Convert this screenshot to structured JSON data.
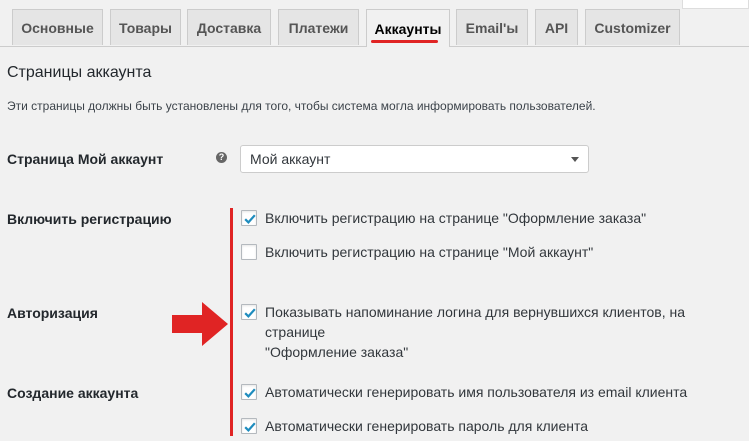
{
  "tabs": [
    {
      "label": "Основные"
    },
    {
      "label": "Товары"
    },
    {
      "label": "Доставка"
    },
    {
      "label": "Платежи"
    },
    {
      "label": "Аккаунты"
    },
    {
      "label": "Email'ы"
    },
    {
      "label": "API"
    },
    {
      "label": "Customizer"
    }
  ],
  "active_tab": "Аккаунты",
  "section": {
    "title": "Страницы аккаунта",
    "description": "Эти страницы должны быть установлены для того, чтобы система могла информировать пользователей."
  },
  "my_account_page": {
    "label": "Страница Мой аккаунт",
    "help_icon_glyph": "?",
    "selected": "Мой аккаунт"
  },
  "registration": {
    "label": "Включить регистрацию",
    "options": [
      {
        "label": "Включить регистрацию на странице \"Оформление заказа\"",
        "checked": true
      },
      {
        "label": "Включить регистрацию на странице \"Мой аккаунт\"",
        "checked": false
      }
    ]
  },
  "authorization": {
    "label": "Авторизация",
    "option_line1": "Показывать напоминание логина для вернувшихся клиентов, на странице",
    "option_line2": "\"Оформление заказа\"",
    "checked": true
  },
  "account_creation": {
    "label": "Создание аккаунта",
    "options": [
      {
        "label": "Автоматически генерировать имя пользователя из email клиента",
        "checked": true
      },
      {
        "label": "Автоматически генерировать пароль для клиента",
        "checked": true
      }
    ]
  },
  "colors": {
    "annotation_red": "#e02424",
    "checkmark_blue": "#1e8cbe"
  },
  "icons": {
    "help": "help-circle-icon",
    "caret": "chevron-down-icon",
    "check": "checkmark-icon",
    "annotation": "red-arrow-icon"
  }
}
